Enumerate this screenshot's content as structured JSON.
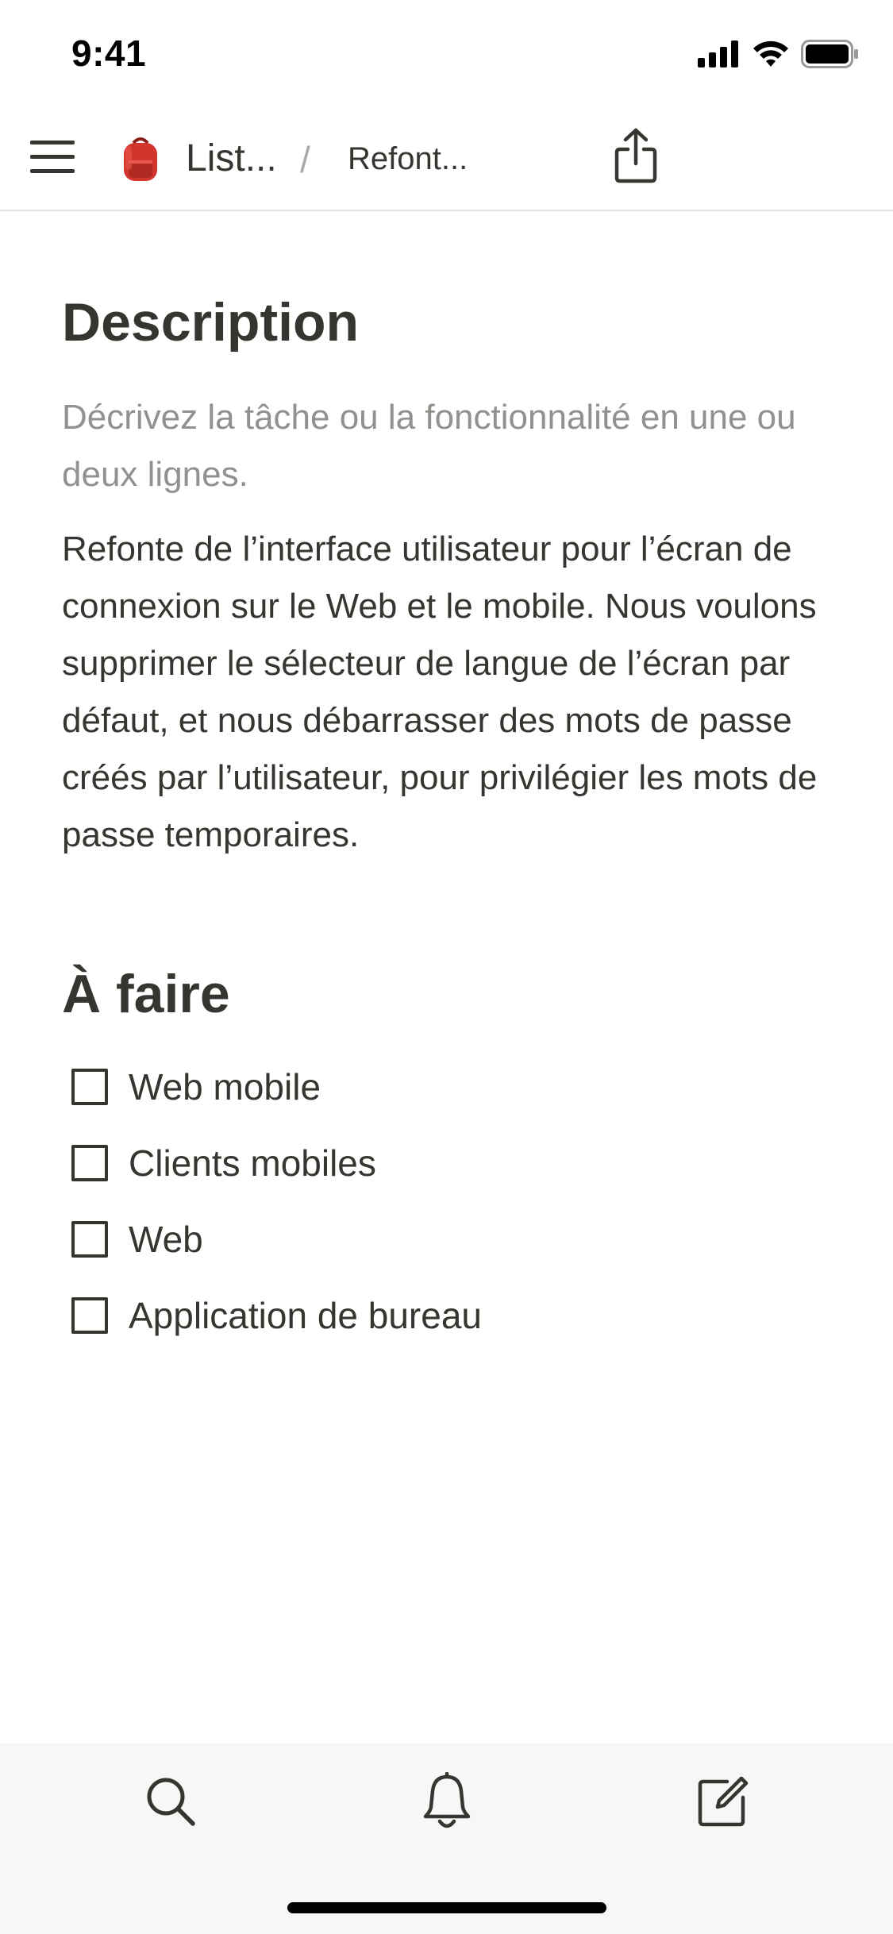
{
  "status_bar": {
    "time": "9:41"
  },
  "nav": {
    "menu_icon": "hamburger-icon",
    "breadcrumb": {
      "parent_emoji": "backpack-icon",
      "parent_label": "List...",
      "separator": "/",
      "current_label": "Refont..."
    },
    "share_icon": "share-icon"
  },
  "content": {
    "description_heading": "Description",
    "description_placeholder": "Décrivez la tâche ou la fonctionnalité en une ou deux lignes.",
    "description_body": "Refonte de l’interface utilisateur pour l’écran de connexion sur le Web et le mobile. Nous voulons supprimer le sélecteur de langue de l’écran par défaut, et nous débarrasser des mots de passe créés par l’utilisateur, pour privilégier les mots de passe temporaires.",
    "todo_heading": "À faire",
    "todos": [
      {
        "label": "Web mobile",
        "checked": false
      },
      {
        "label": "Clients mobiles",
        "checked": false
      },
      {
        "label": "Web",
        "checked": false
      },
      {
        "label": "Application de bureau",
        "checked": false
      }
    ]
  },
  "tab_bar": {
    "tabs": [
      {
        "icon": "search-icon"
      },
      {
        "icon": "bell-icon"
      },
      {
        "icon": "compose-icon"
      }
    ]
  },
  "colors": {
    "text": "#37352f",
    "placeholder": "#91918e",
    "tab_bar_bg": "#f7f7f7",
    "backpack_red": "#d1352b"
  }
}
